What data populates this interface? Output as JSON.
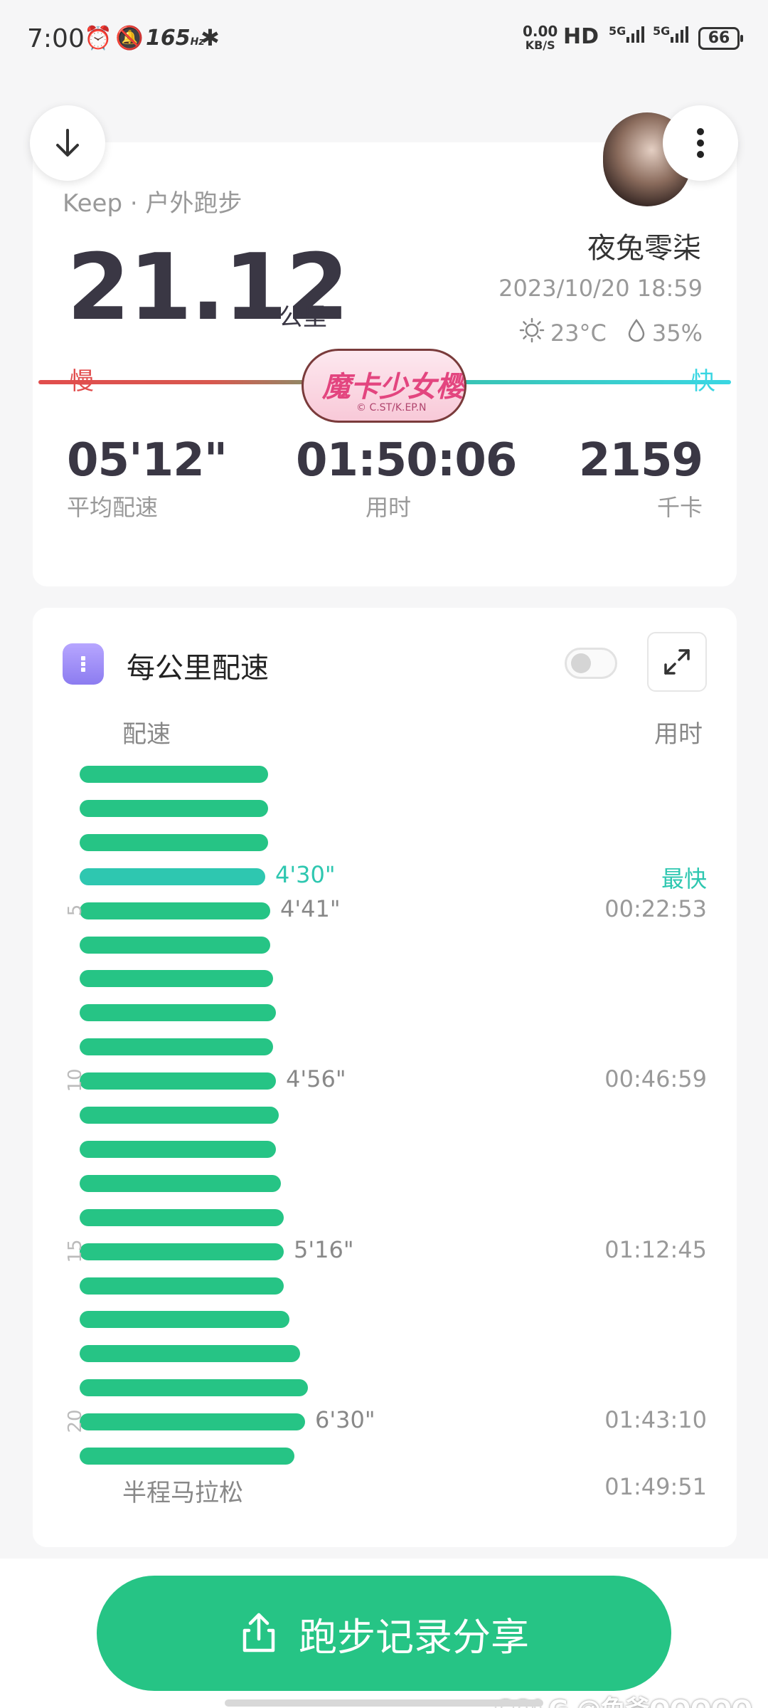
{
  "status_bar": {
    "time": "7:00",
    "refresh_rate": "165",
    "refresh_unit": "Hz",
    "speed_value": "0.00",
    "speed_unit": "KB/S",
    "hd": "HD",
    "network1": "5G",
    "network2": "5G",
    "battery": "66"
  },
  "header": {
    "source": "Keep · 户外跑步",
    "distance": "21.12",
    "distance_unit": "公里",
    "user_name": "夜兔零柒",
    "datetime": "2023/10/20 18:59",
    "temperature": "23°C",
    "humidity": "35%"
  },
  "pace_scale": {
    "slow_label": "慢",
    "fast_label": "快",
    "badge_text": "魔卡少女樱",
    "badge_sub": "© C.ST/K.EP.N"
  },
  "summary": {
    "avg_pace": "05'12\"",
    "avg_pace_label": "平均配速",
    "duration": "01:50:06",
    "duration_label": "用时",
    "calories": "2159",
    "calories_label": "千卡"
  },
  "splits": {
    "title": "每公里配速",
    "col_pace": "配速",
    "col_time": "用时",
    "fastest_label": "最快",
    "half_marathon_label": "半程马拉松",
    "half_marathon_time": "01:49:51",
    "rows": [
      {
        "km": 1,
        "pace_rel": 0.71
      },
      {
        "km": 2,
        "pace_rel": 0.71
      },
      {
        "km": 3,
        "pace_rel": 0.71
      },
      {
        "km": 4,
        "pace_rel": 0.7,
        "pace": "4'30\"",
        "fastest": true
      },
      {
        "km": 5,
        "pace_rel": 0.72,
        "pace": "4'41\"",
        "time": "00:22:53",
        "marker": "5"
      },
      {
        "km": 6,
        "pace_rel": 0.72
      },
      {
        "km": 7,
        "pace_rel": 0.73
      },
      {
        "km": 8,
        "pace_rel": 0.74
      },
      {
        "km": 9,
        "pace_rel": 0.73
      },
      {
        "km": 10,
        "pace_rel": 0.74,
        "pace": "4'56\"",
        "time": "00:46:59",
        "marker": "10"
      },
      {
        "km": 11,
        "pace_rel": 0.75
      },
      {
        "km": 12,
        "pace_rel": 0.74
      },
      {
        "km": 13,
        "pace_rel": 0.76
      },
      {
        "km": 14,
        "pace_rel": 0.77
      },
      {
        "km": 15,
        "pace_rel": 0.77,
        "pace": "5'16\"",
        "time": "01:12:45",
        "marker": "15"
      },
      {
        "km": 16,
        "pace_rel": 0.77
      },
      {
        "km": 17,
        "pace_rel": 0.79
      },
      {
        "km": 18,
        "pace_rel": 0.83
      },
      {
        "km": 19,
        "pace_rel": 0.86
      },
      {
        "km": 20,
        "pace_rel": 0.85,
        "pace": "6'30\"",
        "time": "01:43:10",
        "marker": "20"
      },
      {
        "km": 21,
        "pace_rel": 0.81
      }
    ]
  },
  "share": {
    "label": "跑步记录分享"
  },
  "watermark": "COLG @兔爷QQQQQ",
  "colors": {
    "accent": "#26c485",
    "fastest": "#2ec7b0",
    "slow": "#e14d4d",
    "fast": "#3ad6e2"
  }
}
